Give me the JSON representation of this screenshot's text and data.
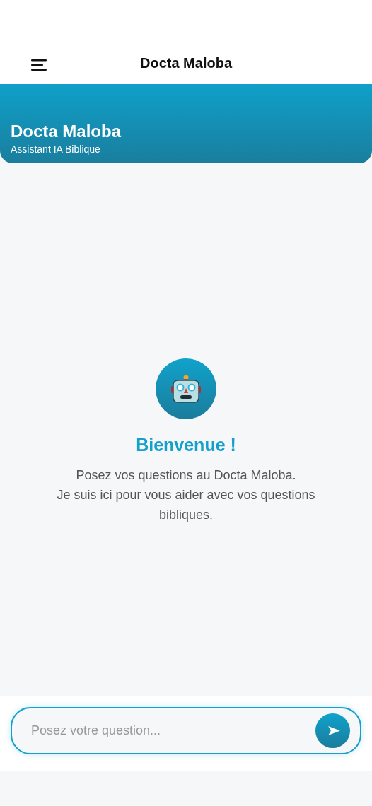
{
  "nav_bar": {
    "title": "Docta Maloba"
  },
  "header": {
    "title": "Docta Maloba",
    "subtitle": "Assistant IA Biblique"
  },
  "welcome": {
    "title": "Bienvenue !",
    "message": "Posez vos questions au Docta Maloba.\nJe suis ici pour vous aider avec vos questions bibliques."
  },
  "composer": {
    "placeholder": "Posez votre question..."
  }
}
